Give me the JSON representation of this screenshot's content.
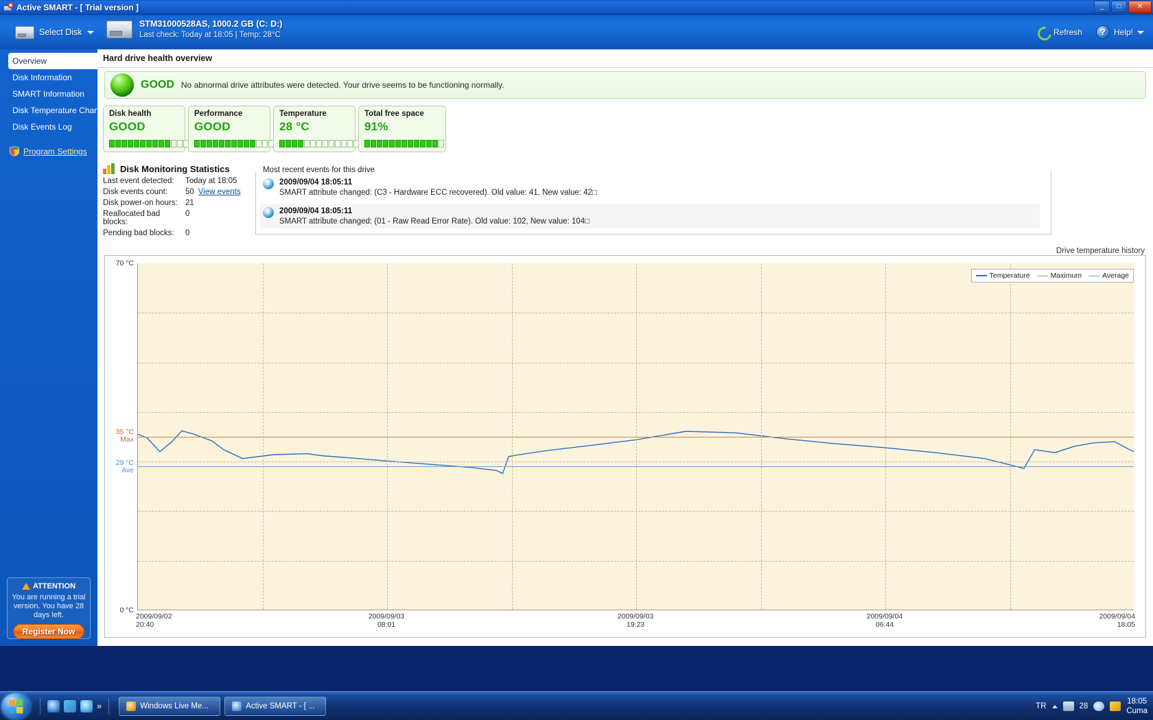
{
  "window": {
    "title": "Active SMART - [ Trial version ]",
    "icon": "app-disk-magnifier-icon",
    "minimize": "0",
    "maximize": "1",
    "close": "x"
  },
  "header": {
    "select_disk_label": "Select Disk",
    "disk_name": "STM31000528AS, 1000.2 GB (C: D:)",
    "disk_subtitle": "Last check: Today at 18:05 | Temp: 28°C",
    "refresh_label": "Refresh",
    "help_label": "Help!",
    "help_glyph": "?",
    "dropdown_caret": "▼"
  },
  "sidebar": {
    "items": [
      {
        "label": "Overview",
        "active": true
      },
      {
        "label": "Disk Information",
        "active": false
      },
      {
        "label": "SMART Information",
        "active": false
      },
      {
        "label": "Disk Temperature Chart",
        "active": false
      },
      {
        "label": "Disk Events Log",
        "active": false
      }
    ],
    "settings_label": "Program Settings",
    "attention": {
      "heading": "ATTENTION",
      "body": "You are running a trial version. You have 28 days left.",
      "button": "Register Now"
    }
  },
  "main": {
    "page_title": "Hard drive health overview",
    "banner": {
      "status": "GOOD",
      "message": "No abnormal drive attributes were detected. Your drive seems to be functioning normally."
    },
    "cards": [
      {
        "title": "Disk health",
        "value": "GOOD",
        "filled": 10,
        "total": 13
      },
      {
        "title": "Performance",
        "value": "GOOD",
        "filled": 10,
        "total": 13
      },
      {
        "title": "Temperature",
        "value": "28 °C",
        "filled": 4,
        "total": 13
      },
      {
        "title": "Total free space",
        "value": "91%",
        "filled": 12,
        "total": 13
      }
    ],
    "stats": {
      "title": "Disk Monitoring Statistics",
      "rows": [
        {
          "key": "Last event detected:",
          "value": "Today at 18:05",
          "link": ""
        },
        {
          "key": "Disk events count:",
          "value": "50",
          "link": "View events"
        },
        {
          "key": "Disk power-on hours:",
          "value": "21",
          "link": ""
        },
        {
          "key": "Reallocated bad blocks:",
          "value": "0",
          "link": ""
        },
        {
          "key": "Pending bad blocks:",
          "value": "0",
          "link": ""
        }
      ]
    },
    "events": {
      "legend": "Most recent events for this drive",
      "rows": [
        {
          "timestamp": "2009/09/04 18:05:11",
          "message": "SMART attribute changed: (C3 - Hardware ECC recovered). Old value: 41, New value: 42□"
        },
        {
          "timestamp": "2009/09/04 18:05:11",
          "message": "SMART attribute changed: (01 - Raw Read Error Rate). Old value: 102, New value: 104□"
        }
      ]
    }
  },
  "chart_data": {
    "type": "line",
    "title": "Drive temperature history",
    "xlabel": "",
    "ylabel": "",
    "ylim": [
      0,
      70
    ],
    "yticks": [
      0,
      70
    ],
    "ytick_labels": [
      "0 °C",
      "70 °C"
    ],
    "grid": true,
    "legend_position": "top-right",
    "legend": [
      "Temperature",
      "Maximum",
      "Average"
    ],
    "colors": {
      "temperature": "#2a6fc4",
      "maximum": "#c08b55",
      "average": "#5aa8e0",
      "plot_bg": "#fcf3dd"
    },
    "annotations": [
      {
        "label": "35 °C",
        "sublabel": "Max",
        "value": 35,
        "color": "#c0703c"
      },
      {
        "label": "29 °C",
        "sublabel": "Ave",
        "value": 29,
        "color": "#4d93d6"
      }
    ],
    "xtick_labels": [
      {
        "date": "2009/09/02",
        "time": "20:40"
      },
      {
        "date": "2009/09/03",
        "time": "08:01"
      },
      {
        "date": "2009/09/03",
        "time": "19:23"
      },
      {
        "date": "2009/09/04",
        "time": "06:44"
      },
      {
        "date": "2009/09/04",
        "time": "18:05"
      }
    ],
    "series": [
      {
        "name": "Temperature",
        "color": "#2a6fc4",
        "x": [
          0.0,
          0.9,
          2.2,
          3.4,
          4.4,
          5.5,
          7.4,
          8.6,
          10.5,
          13.6,
          17.0,
          18.4,
          21.0,
          24.5,
          29.0,
          33.5,
          36.0,
          36.6,
          37.2,
          38.0,
          41.0,
          46.0,
          50.0,
          55.0,
          60.0,
          65.0,
          70.0,
          75.0,
          80.0,
          85.0,
          88.2,
          88.9,
          90.0,
          92.0,
          94.0,
          96.0,
          98.0,
          100.0
        ],
        "y": [
          35.5,
          34.8,
          32.0,
          34.0,
          36.2,
          35.6,
          34.2,
          32.4,
          30.6,
          31.4,
          31.6,
          31.2,
          30.8,
          30.2,
          29.5,
          28.8,
          28.2,
          27.6,
          31.0,
          31.3,
          32.2,
          33.4,
          34.4,
          36.1,
          35.8,
          34.6,
          33.6,
          32.8,
          31.8,
          30.6,
          29.0,
          28.6,
          32.4,
          31.8,
          33.1,
          33.8,
          34.0,
          31.9
        ]
      },
      {
        "name": "Maximum",
        "color": "#c08b55",
        "constant": 35
      },
      {
        "name": "Average",
        "color": "#5aa8e0",
        "constant": 29
      }
    ]
  },
  "taskbar": {
    "start_label": "Start",
    "quicklaunch_more": "»",
    "tasks": [
      {
        "label": "Windows Live Me...",
        "icon": "wlm-icon"
      },
      {
        "label": "Active SMART - [ ...",
        "icon": "active-smart-icon"
      }
    ],
    "tray": {
      "language": "TR",
      "temperature": "28",
      "time": "18:05",
      "day": "Cuma"
    }
  }
}
